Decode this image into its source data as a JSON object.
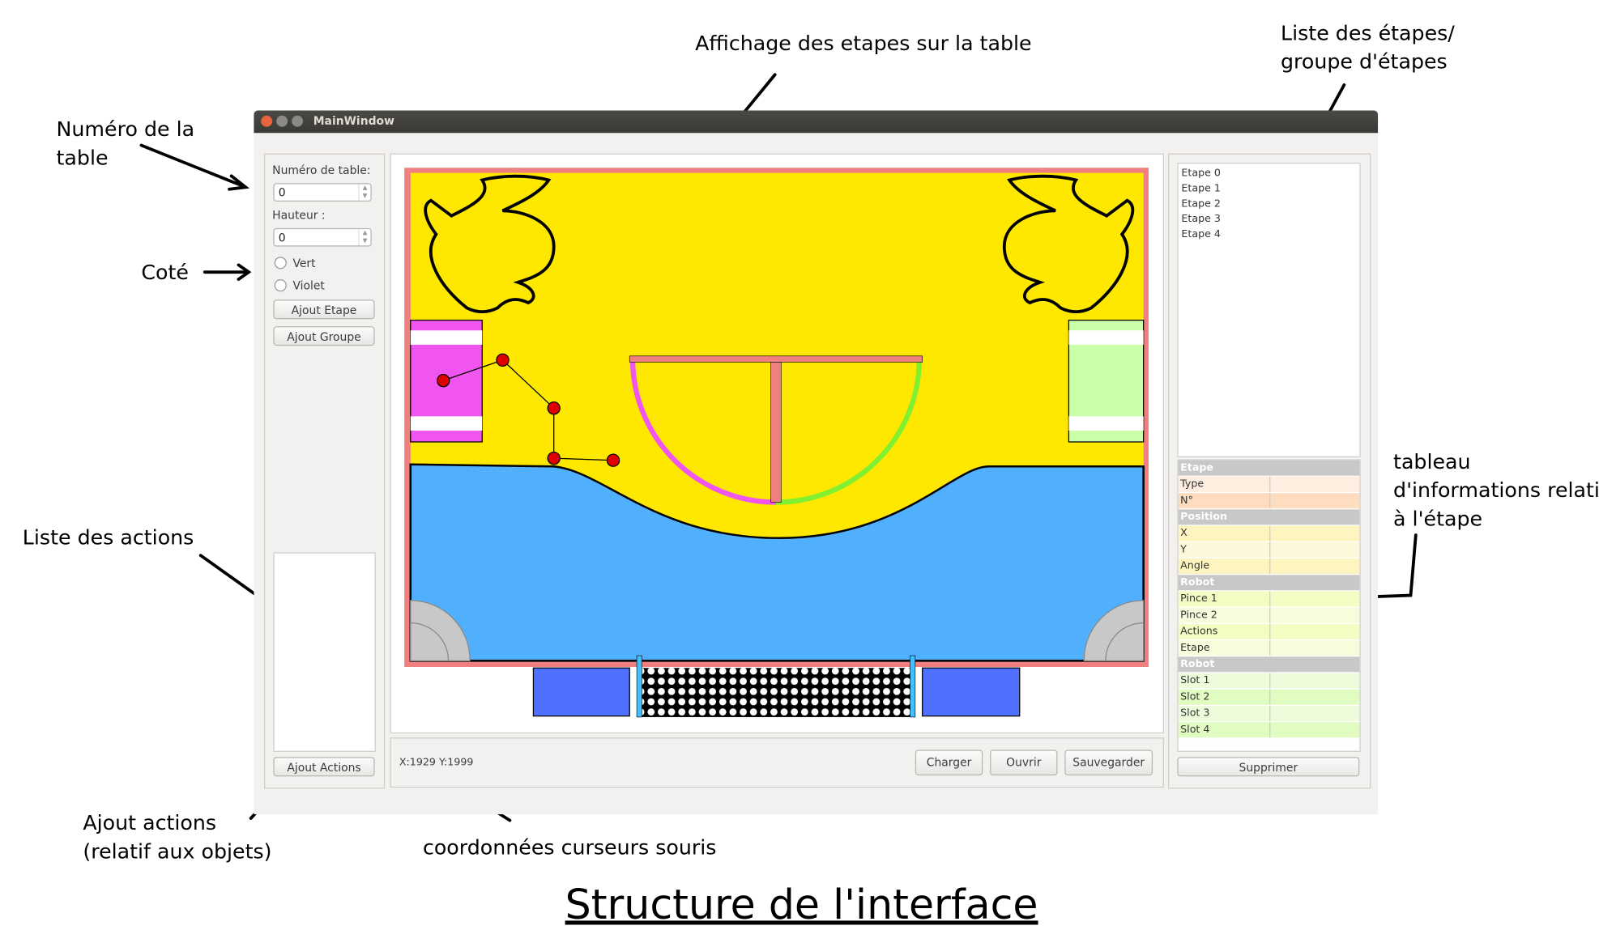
{
  "annotations": {
    "numero_table": "Numéro de la\ntable",
    "cote": "Coté",
    "liste_actions": "Liste des actions",
    "ajout_actions": "Ajout actions\n(relatif aux objets)",
    "coordonnees": "coordonnées curseurs souris",
    "affichage": "Affichage des etapes sur la table",
    "liste_etapes": "Liste des étapes/\ngroupe d'étapes",
    "tableau": "tableau\nd'informations relatif\nà l'étape",
    "title": "Structure de l'interface"
  },
  "window": {
    "title": "MainWindow"
  },
  "left_panel": {
    "table_number_label": "Numéro de table:",
    "table_number_value": "0",
    "height_label": "Hauteur :",
    "height_value": "0",
    "radio_green": "Vert",
    "radio_violet": "Violet",
    "add_step": "Ajout Etape",
    "add_group": "Ajout Groupe",
    "add_actions": "Ajout Actions"
  },
  "bottom_bar": {
    "cursor_coords": "X:1929 Y:1999",
    "load": "Charger",
    "open": "Ouvrir",
    "save": "Sauvegarder"
  },
  "steps": [
    "Etape 0",
    "Etape 1",
    "Etape 2",
    "Etape 3",
    "Etape 4"
  ],
  "info_table": [
    {
      "header": "Etape"
    },
    {
      "key": "Type",
      "color": "#fdeee0"
    },
    {
      "key": "N°",
      "color": "#fddcbf"
    },
    {
      "header": "Position"
    },
    {
      "key": "X",
      "color": "#fdf4c0"
    },
    {
      "key": "Y",
      "color": "#fdf8dc"
    },
    {
      "key": "Angle",
      "color": "#fdf4c0"
    },
    {
      "header": "Robot"
    },
    {
      "key": "Pince 1",
      "color": "#f4fcc4"
    },
    {
      "key": "Pince 2",
      "color": "#f6fcdc"
    },
    {
      "key": "Actions",
      "color": "#f4fcc4"
    },
    {
      "key": "Etape",
      "color": "#f6fcdc"
    },
    {
      "header": "Robot"
    },
    {
      "key": "Slot 1",
      "color": "#eefcdc"
    },
    {
      "key": "Slot 2",
      "color": "#e0fcc0"
    },
    {
      "key": "Slot 3",
      "color": "#eefcdc"
    },
    {
      "key": "Slot 4",
      "color": "#e0fcc0"
    }
  ],
  "delete": "Supprimer",
  "colors": {
    "field": "#ffe800",
    "border": "#f08080",
    "water": "#50b0fd",
    "violet": "#f055f0",
    "green_zone": "#ccffaa",
    "path": "#e00000"
  }
}
